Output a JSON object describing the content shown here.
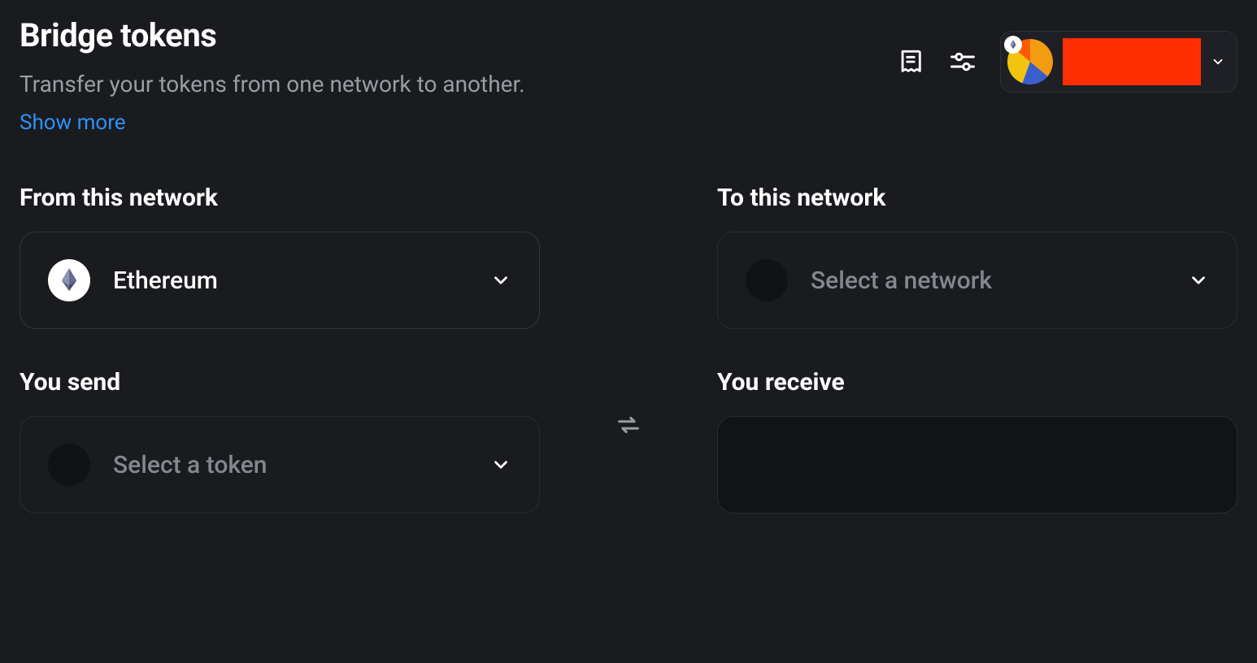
{
  "header": {
    "title": "Bridge tokens",
    "subtitle": "Transfer your tokens from one network to another.",
    "show_more": "Show more"
  },
  "controls": {
    "receipt_icon": "receipt-icon",
    "settings_icon": "sliders-icon",
    "account_badge_icon": "ethereum-icon"
  },
  "from_network": {
    "label": "From this network",
    "selected_name": "Ethereum",
    "icon": "ethereum-icon"
  },
  "to_network": {
    "label": "To this network",
    "placeholder": "Select a network"
  },
  "you_send": {
    "label": "You send",
    "placeholder": "Select a token"
  },
  "you_receive": {
    "label": "You receive"
  },
  "swap_icon": "swap-horizontal-icon"
}
